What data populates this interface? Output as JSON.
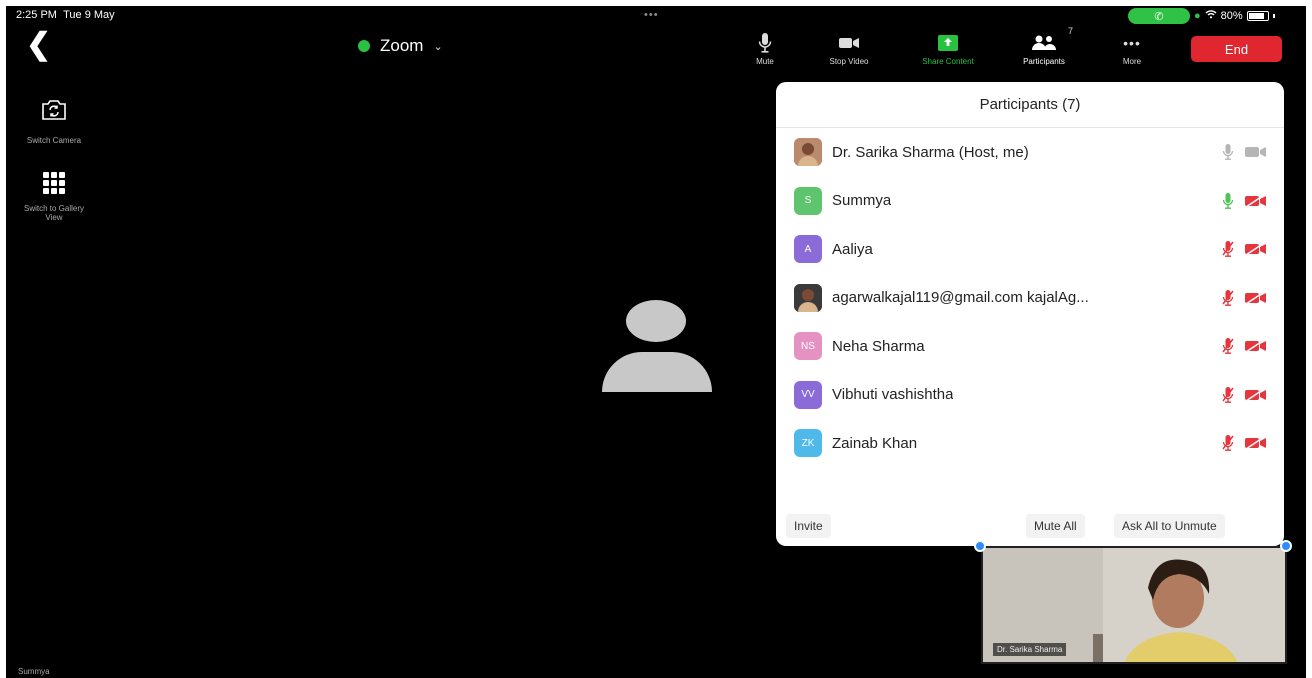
{
  "status_bar": {
    "time": "2:25 PM",
    "date": "Tue 9 May",
    "battery": "80%",
    "dots": "•••"
  },
  "toolbar": {
    "meeting_title": "Zoom",
    "mute_label": "Mute",
    "stop_video_label": "Stop Video",
    "share_content_label": "Share Content",
    "participants_label": "Participants",
    "participants_count": "7",
    "more_label": "More",
    "end_label": "End"
  },
  "side_controls": {
    "switch_camera_label": "Switch Camera",
    "switch_gallery_label": "Switch to Gallery View"
  },
  "active_speaker_name": "Summya",
  "participants_panel": {
    "title": "Participants (7)",
    "participants": [
      {
        "name": "Dr. Sarika Sharma (Host, me)",
        "initials": "",
        "avatar_type": "photo",
        "avatar_color": "#b98a6d",
        "mic": "on",
        "video": "on"
      },
      {
        "name": "Summya",
        "initials": "S",
        "avatar_type": "initials",
        "avatar_color": "#5ec46d",
        "mic": "speaking",
        "video": "off"
      },
      {
        "name": "Aaliya",
        "initials": "A",
        "avatar_type": "initials",
        "avatar_color": "#8a6bd8",
        "mic": "muted",
        "video": "off"
      },
      {
        "name": "agarwalkajal119@gmail.com kajalAg...",
        "initials": "",
        "avatar_type": "photo",
        "avatar_color": "#3a3a3a",
        "mic": "muted",
        "video": "off"
      },
      {
        "name": "Neha Sharma",
        "initials": "NS",
        "avatar_type": "initials",
        "avatar_color": "#e591c2",
        "mic": "muted",
        "video": "off"
      },
      {
        "name": "Vibhuti vashishtha",
        "initials": "VV",
        "avatar_type": "initials",
        "avatar_color": "#8a6bd8",
        "mic": "muted",
        "video": "off"
      },
      {
        "name": "Zainab Khan",
        "initials": "ZK",
        "avatar_type": "initials",
        "avatar_color": "#4fb9ea",
        "mic": "muted",
        "video": "off"
      }
    ],
    "invite_label": "Invite",
    "mute_all_label": "Mute All",
    "ask_unmute_label": "Ask All to Unmute"
  },
  "self_view": {
    "name": "Dr. Sarika Sharma"
  },
  "colors": {
    "end_red": "#e0262f",
    "share_green": "#28c140",
    "muted_red": "#e5363d",
    "accent_blue": "#2d8cff"
  }
}
